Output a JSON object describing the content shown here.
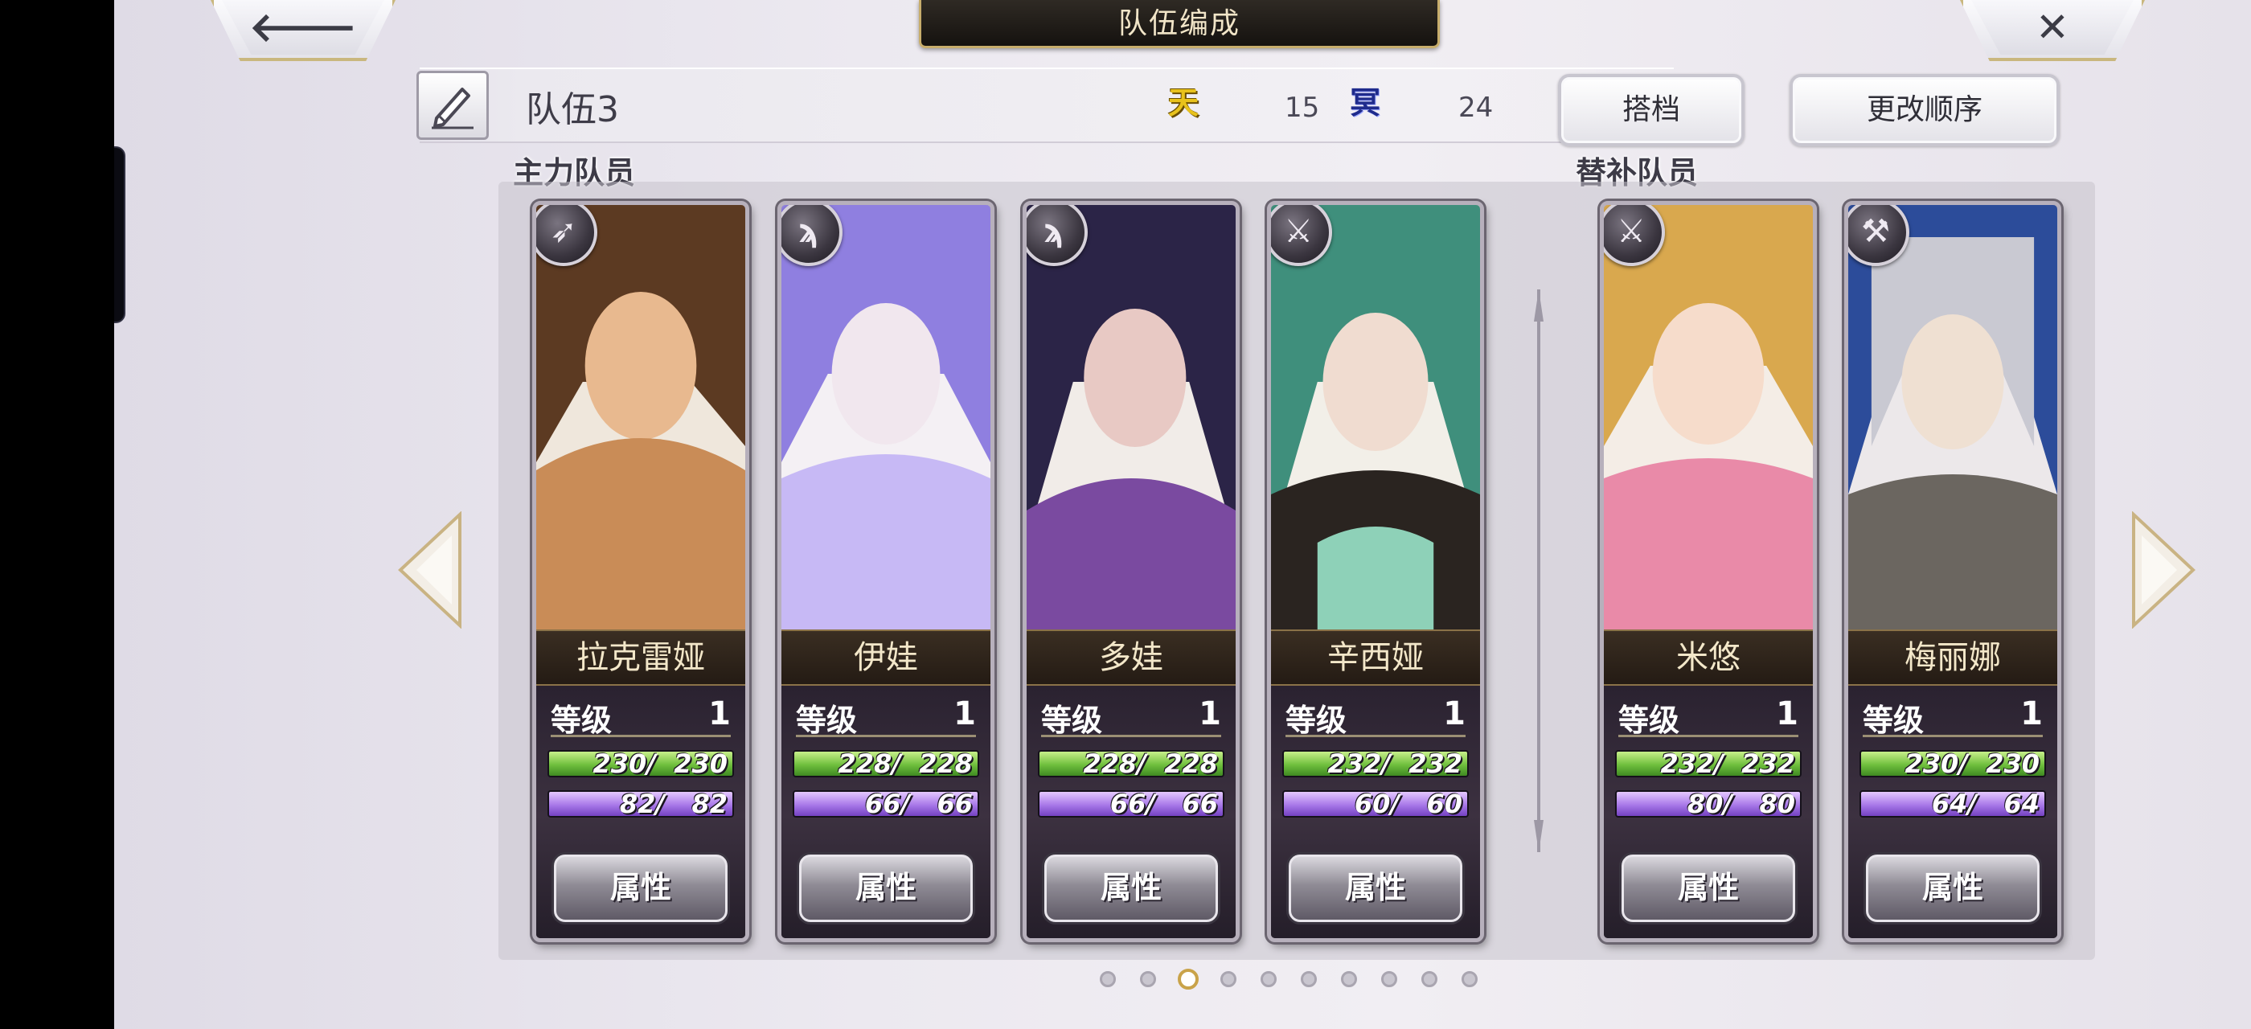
{
  "header": {
    "title": "队伍编成",
    "back_icon": "back-arrow-icon",
    "close_icon": "close-icon",
    "back_glyph": "🡐",
    "close_glyph": "✕"
  },
  "team": {
    "name": "队伍3",
    "sky_label": "天",
    "sky_count": "15",
    "underworld_label": "冥",
    "underworld_count": "24"
  },
  "buttons": {
    "hitch": "搭档",
    "change_order": "更改顺序"
  },
  "sections": {
    "main": "主力队员",
    "sub": "替补队员"
  },
  "characters": [
    {
      "name": "拉克雷娅",
      "weapon": "bow-icon",
      "weapon_glyph": "➶",
      "level_label": "等级",
      "level": "1",
      "hp": "230/  230",
      "hp_ratio": 1.0,
      "mp": "82/   82",
      "mp_ratio": 1.0,
      "attr_label": "属性",
      "colors": [
        "#5c3a22",
        "#c98c57",
        "#e8b98f"
      ]
    },
    {
      "name": "伊娃",
      "weapon": "staff-icon",
      "weapon_glyph": "ϡ",
      "level_label": "等级",
      "level": "1",
      "hp": "228/  228",
      "hp_ratio": 1.0,
      "mp": "66/   66",
      "mp_ratio": 1.0,
      "attr_label": "属性",
      "colors": [
        "#8f7fe0",
        "#c7b9f5",
        "#f1e7ee"
      ]
    },
    {
      "name": "多娃",
      "weapon": "staff-icon",
      "weapon_glyph": "ϡ",
      "level_label": "等级",
      "level": "1",
      "hp": "228/  228",
      "hp_ratio": 1.0,
      "mp": "66/   66",
      "mp_ratio": 1.0,
      "attr_label": "属性",
      "colors": [
        "#2b2447",
        "#7a4aa0",
        "#e8c9c4"
      ]
    },
    {
      "name": "辛西娅",
      "weapon": "sword-icon",
      "weapon_glyph": "⚔",
      "level_label": "等级",
      "level": "1",
      "hp": "232/  232",
      "hp_ratio": 1.0,
      "mp": "60/   60",
      "mp_ratio": 1.0,
      "attr_label": "属性",
      "colors": [
        "#3f8f7c",
        "#8ed1b8",
        "#f0dcd0"
      ]
    },
    {
      "name": "米悠",
      "weapon": "sword-icon",
      "weapon_glyph": "⚔",
      "level_label": "等级",
      "level": "1",
      "hp": "232/  232",
      "hp_ratio": 1.0,
      "mp": "80/   80",
      "mp_ratio": 1.0,
      "attr_label": "属性",
      "colors": [
        "#d9a84e",
        "#e98aa8",
        "#f6dccb"
      ]
    },
    {
      "name": "梅丽娜",
      "weapon": "hammer-icon",
      "weapon_glyph": "⚒",
      "level_label": "等级",
      "level": "1",
      "hp": "230/  230",
      "hp_ratio": 1.0,
      "mp": "64/   64",
      "mp_ratio": 1.0,
      "attr_label": "属性",
      "colors": [
        "#c9c9d2",
        "#2c4c9a",
        "#efe0d2"
      ]
    }
  ],
  "pagination": {
    "count": 10,
    "active_index": 2
  },
  "accent_colors": {
    "gold": "#c7ad6c",
    "hp": "#6fbf3d",
    "mp": "#a878e8"
  }
}
